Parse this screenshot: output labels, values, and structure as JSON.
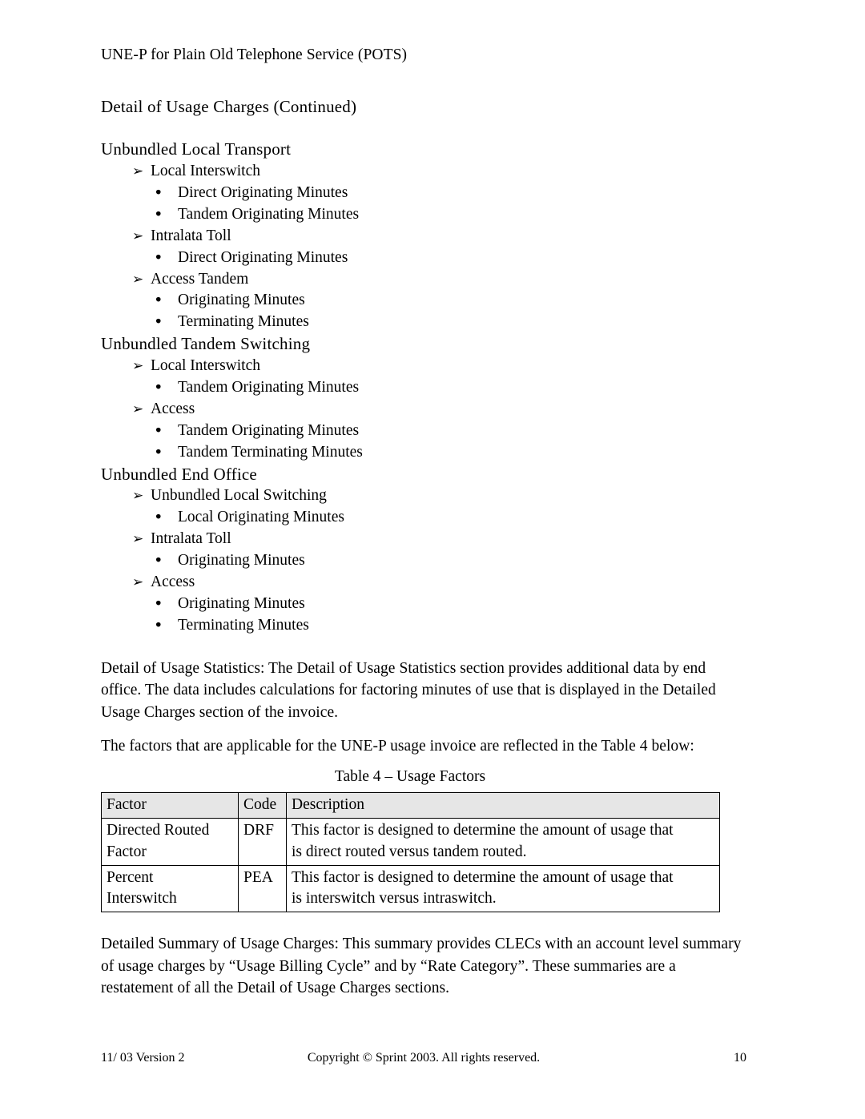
{
  "running_head": "UNE-P for Plain Old Telephone Service (POTS)",
  "section_title": "Detail of Usage Charges (Continued)",
  "bullets": {
    "level1_glyph": "➢",
    "level2_glyph": "•"
  },
  "groups": [
    {
      "title": "Unbundled Local Transport",
      "items": [
        {
          "label": "Local Interswitch",
          "subitems": [
            "Direct Originating Minutes",
            "Tandem Originating Minutes"
          ]
        },
        {
          "label": "Intralata Toll",
          "subitems": [
            "Direct Originating Minutes"
          ]
        },
        {
          "label": "Access Tandem",
          "subitems": [
            "Originating Minutes",
            "Terminating Minutes"
          ]
        }
      ]
    },
    {
      "title": "Unbundled Tandem Switching",
      "items": [
        {
          "label": "Local Interswitch",
          "subitems": [
            "Tandem Originating Minutes"
          ]
        },
        {
          "label": "Access",
          "subitems": [
            "Tandem Originating Minutes",
            "Tandem Terminating Minutes"
          ]
        }
      ]
    },
    {
      "title": "Unbundled End Office",
      "items": [
        {
          "label": "Unbundled Local Switching",
          "subitems": [
            "Local Originating Minutes"
          ]
        },
        {
          "label": "Intralata Toll",
          "subitems": [
            "Originating Minutes"
          ]
        },
        {
          "label": "Access",
          "subitems": [
            "Originating Minutes",
            "Terminating Minutes"
          ]
        }
      ]
    }
  ],
  "paragraphs": {
    "usage_statistics": "Detail of Usage Statistics: The Detail of Usage Statistics section provides additional data by end office. The data includes calculations for factoring minutes of use that is displayed in the Detailed Usage Charges section of the invoice.",
    "factors_intro": "The factors that are applicable for the UNE-P usage invoice are reflected in the Table 4 below:",
    "detailed_summary": "Detailed Summary of Usage Charges: This summary provides CLECs with an account level summary of usage charges by “Usage Billing Cycle” and by “Rate Category”. These summaries are a restatement of all the Detail of Usage Charges sections."
  },
  "table": {
    "caption": "Table 4 – Usage Factors",
    "headers": [
      "Factor",
      "Code",
      "Description"
    ],
    "header_bg": "#e6e6e6",
    "rows": [
      {
        "factor_line1": "Directed Routed",
        "factor_line2": "Factor",
        "code": "DRF",
        "desc_line1": "This factor is designed to determine the amount of usage that",
        "desc_line2": "is direct routed versus tandem routed."
      },
      {
        "factor_line1": "Percent",
        "factor_line2": "Interswitch",
        "code": "PEA",
        "desc_line1": "This factor is designed to determine the amount of usage that",
        "desc_line2": "is interswitch versus intraswitch."
      }
    ]
  },
  "footer": {
    "left": "11/ 03 Version 2",
    "center": "Copyright © Sprint 2003. All rights reserved.",
    "page_number": "10"
  }
}
